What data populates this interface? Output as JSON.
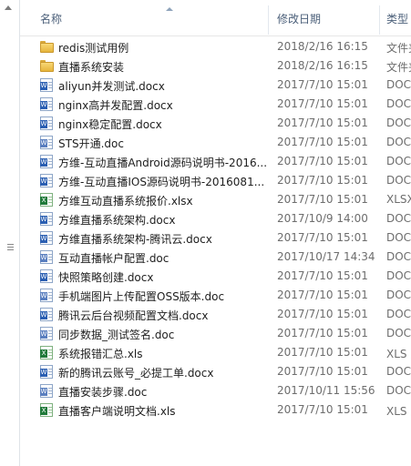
{
  "columns": {
    "name": "名称",
    "date": "修改日期",
    "type": "类型"
  },
  "files": [
    {
      "name": "redis测试用例",
      "date": "2018/2/16 16:15",
      "type": "文件夹",
      "icon": "folder-icon"
    },
    {
      "name": "直播系统安装",
      "date": "2018/2/16 16:15",
      "type": "文件夹",
      "icon": "folder-icon"
    },
    {
      "name": "aliyun并发测试.docx",
      "date": "2017/7/10 15:01",
      "type": "DOCX",
      "icon": "word-document-icon"
    },
    {
      "name": "nginx高并发配置.docx",
      "date": "2017/7/10 15:01",
      "type": "DOCX",
      "icon": "word-document-icon"
    },
    {
      "name": "nginx稳定配置.docx",
      "date": "2017/7/10 15:01",
      "type": "DOCX",
      "icon": "word-document-icon"
    },
    {
      "name": "STS开通.doc",
      "date": "2017/7/10 15:01",
      "type": "DOC",
      "icon": "word-document-icon"
    },
    {
      "name": "方维-互动直播Android源码说明书-2016...",
      "date": "2017/7/10 15:01",
      "type": "DOCX",
      "icon": "word-document-icon"
    },
    {
      "name": "方维-互动直播IOS源码说明书-2016081...",
      "date": "2017/7/10 15:01",
      "type": "DOCX",
      "icon": "word-document-icon"
    },
    {
      "name": "方维互动直播系统报价.xlsx",
      "date": "2017/7/10 15:01",
      "type": "XLSX",
      "icon": "excel-document-icon"
    },
    {
      "name": "方维直播系统架构.docx",
      "date": "2017/10/9 14:00",
      "type": "DOCX",
      "icon": "word-document-icon"
    },
    {
      "name": "方维直播系统架构-腾讯云.docx",
      "date": "2017/7/10 15:01",
      "type": "DOCX",
      "icon": "word-document-icon"
    },
    {
      "name": "互动直播帐户配置.doc",
      "date": "2017/10/17 14:34",
      "type": "DOC",
      "icon": "word-document-icon"
    },
    {
      "name": "快照策略创建.docx",
      "date": "2017/7/10 15:01",
      "type": "DOCX",
      "icon": "word-document-icon"
    },
    {
      "name": "手机端图片上传配置OSS版本.doc",
      "date": "2017/7/10 15:01",
      "type": "DOC",
      "icon": "word-document-icon"
    },
    {
      "name": "腾讯云后台视频配置文档.docx",
      "date": "2017/7/10 15:01",
      "type": "DOCX",
      "icon": "word-document-icon"
    },
    {
      "name": "同步数据_测试签名.doc",
      "date": "2017/7/10 15:01",
      "type": "DOC",
      "icon": "word-document-icon"
    },
    {
      "name": "系统报错汇总.xls",
      "date": "2017/7/10 15:01",
      "type": "XLS 工",
      "icon": "excel-document-icon"
    },
    {
      "name": "新的腾讯云账号_必提工单.docx",
      "date": "2017/7/10 15:01",
      "type": "DOCX",
      "icon": "word-document-icon"
    },
    {
      "name": "直播安装步骤.doc",
      "date": "2017/10/11 15:56",
      "type": "DOC",
      "icon": "word-document-icon"
    },
    {
      "name": "直播客户端说明文档.xls",
      "date": "2017/7/10 15:01",
      "type": "XLS 工",
      "icon": "excel-document-icon"
    }
  ]
}
